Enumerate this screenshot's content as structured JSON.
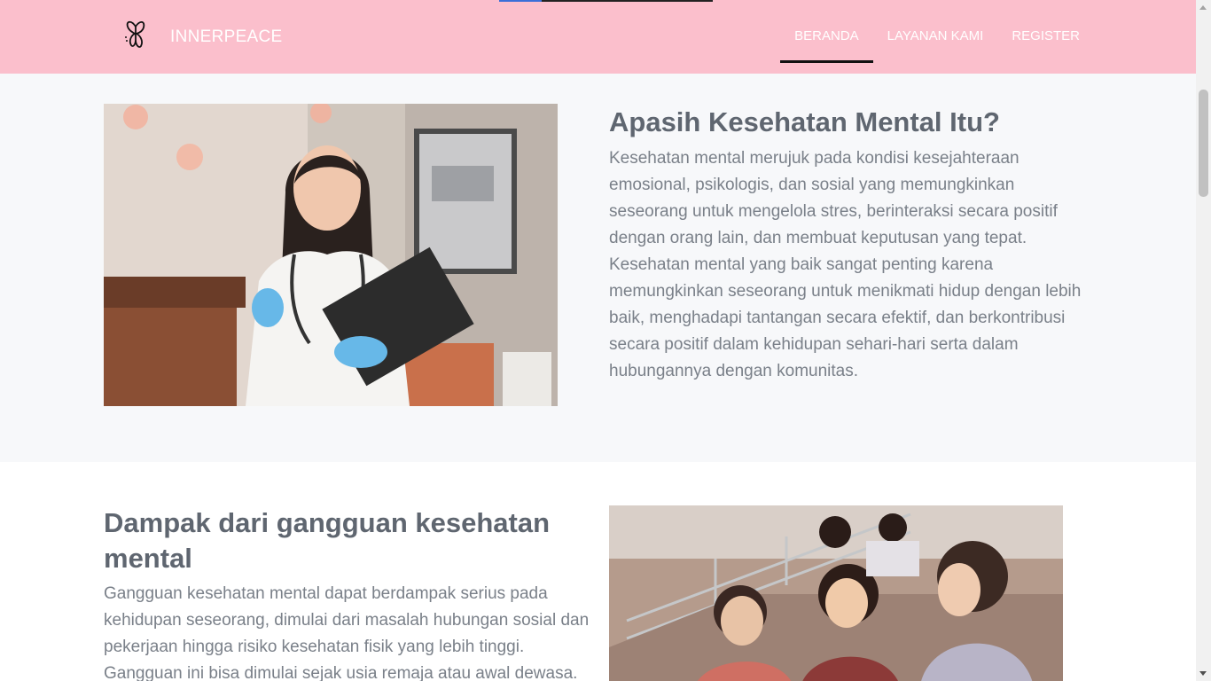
{
  "navbar": {
    "brand": "INNERPEACE",
    "logo_icon": "butterfly-icon",
    "links": [
      {
        "label": "BERANDA",
        "active": true
      },
      {
        "label": "LAYANAN KAMI",
        "active": false
      },
      {
        "label": "REGISTER",
        "active": false
      }
    ],
    "bg_color": "#fbbfcc"
  },
  "section1": {
    "heading": "Apasih Kesehatan Mental Itu?",
    "paragraph": "Kesehatan mental merujuk pada kondisi kesejahteraan emosional, psikologis, dan sosial yang memungkinkan seseorang untuk mengelola stres, berinteraksi secara positif dengan orang lain, dan membuat keputusan yang tepat. Kesehatan mental yang baik sangat penting karena memungkinkan seseorang untuk menikmati hidup dengan lebih baik, menghadapi tantangan secara efektif, dan berkontribusi secara positif dalam kehidupan sehari-hari serta dalam hubungannya dengan komunitas."
  },
  "section2": {
    "heading": "Dampak dari gangguan kesehatan mental",
    "paragraph": "Gangguan kesehatan mental dapat berdampak serius pada kehidupan seseorang, dimulai dari masalah hubungan sosial dan pekerjaan hingga risiko kesehatan fisik yang lebih tinggi. Gangguan ini bisa dimulai sejak usia remaja atau awal dewasa."
  }
}
